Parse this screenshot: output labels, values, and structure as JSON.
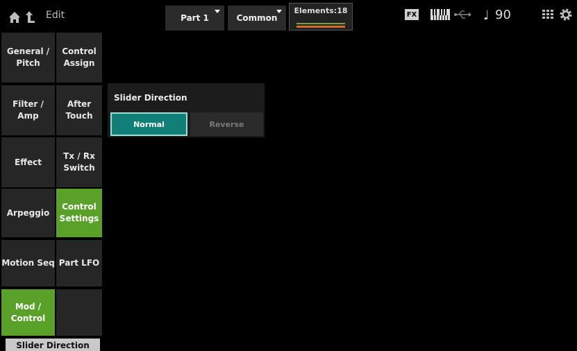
{
  "header": {
    "edit_label": "Edit",
    "part_label": "Part 1",
    "common_label": "Common",
    "elements_label": "Elements:18",
    "fx_label": "FX",
    "tempo_note": "♩",
    "tempo_value": "90"
  },
  "tabs": {
    "general_pitch": "General / Pitch",
    "control_assign": "Control Assign",
    "filter_amp": "Filter / Amp",
    "after_touch": "After Touch",
    "effect": "Effect",
    "tx_rx_switch": "Tx / Rx Switch",
    "arpeggio": "Arpeggio",
    "control_settings": "Control Settings",
    "motion_seq": "Motion Seq",
    "part_lfo": "Part LFO",
    "mod_control": "Mod / Control",
    "empty": ""
  },
  "bottom_tab": "Slider Direction",
  "panel": {
    "title": "Slider Direction",
    "options": [
      "Normal",
      "Reverse"
    ],
    "selected": "Normal"
  },
  "colors": {
    "active_tab": "#5aa12a",
    "selected_option": "#117e78",
    "selected_border": "#9fe0d8"
  }
}
